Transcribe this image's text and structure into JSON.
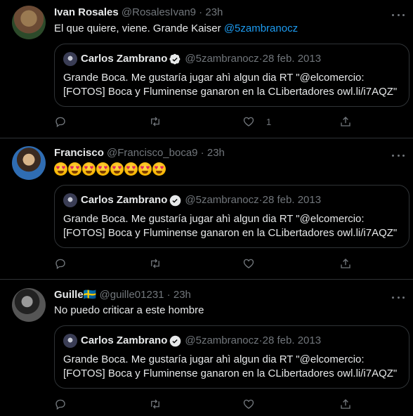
{
  "tweets": [
    {
      "name": "Ivan Rosales",
      "handle": "@RosalesIvan9",
      "time": "23h",
      "text_plain": "El que quiere, viene. Grande Kaiser ",
      "text_mention": "@5zambranocz",
      "like_count": "1",
      "avatar_colors": [
        "#6b4a34",
        "#9a7a52",
        "#2c4a2a"
      ]
    },
    {
      "name": "Francisco",
      "handle": "@Francisco_boca9",
      "time": "23h",
      "emoji_count": 8,
      "emoji_name": "heart-eyes-emoji",
      "like_count": "",
      "avatar_colors": [
        "#2f6db3",
        "#3b2a20",
        "#d9b58a"
      ]
    },
    {
      "name": "Guille",
      "flag": "🇸🇪",
      "handle": "@guille01231",
      "time": "23h",
      "text_plain": "No puedo criticar a este hombre",
      "like_count": "",
      "avatar_colors": [
        "#555555",
        "#999999",
        "#222222"
      ]
    }
  ],
  "quoted": {
    "name": "Carlos Zambrano",
    "handle": "@5zambranocz",
    "date": "28 feb. 2013",
    "line1": "Grande Boca. Me gustaría jugar ahì algun dia RT \"@elcomercio:",
    "line2": "[FOTOS] Boca y Fluminense ganaron en la CLibertadores owl.li/i7AQZ\""
  },
  "separator": " · ",
  "colors": {
    "accent": "#1d9bf0",
    "muted": "#71767b",
    "text": "#e7e9ea",
    "border": "#2f3336",
    "background": "#000000"
  },
  "icons": [
    "reply-icon",
    "retweet-icon",
    "like-icon",
    "share-icon",
    "verified-icon",
    "more-icon"
  ]
}
